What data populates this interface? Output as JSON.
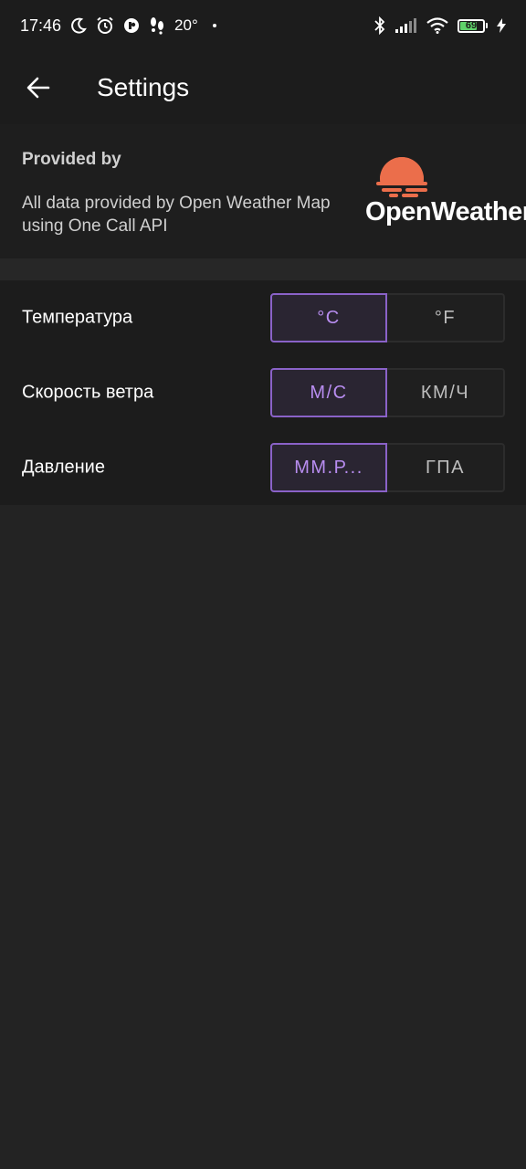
{
  "status_bar": {
    "time": "17:46",
    "temperature": "20°",
    "battery": "69",
    "icons": [
      "moon-icon",
      "alarm-icon",
      "app-notification-icon",
      "footsteps-icon",
      "bluetooth-icon",
      "signal-icon",
      "wifi-icon",
      "battery-icon",
      "charging-icon"
    ]
  },
  "app_bar": {
    "title": "Settings",
    "back_icon": "arrow-left-icon"
  },
  "provider": {
    "heading": "Provided by",
    "description": "All data provided by Open Weather Map using One Call API",
    "logo_text": "OpenWeather",
    "logo_color": "#eb6e4b"
  },
  "settings": [
    {
      "label": "Температура",
      "options": [
        "°C",
        "°F"
      ],
      "selected": 0
    },
    {
      "label": "Скорость ветра",
      "options": [
        "М/С",
        "КМ/Ч"
      ],
      "selected": 0
    },
    {
      "label": "Давление",
      "options": [
        "ММ.Р...",
        "ГПА"
      ],
      "selected": 0
    }
  ],
  "colors": {
    "accent": "#b88df0",
    "accent_border": "#8a62c8",
    "background": "#232323",
    "surface": "#1c1c1c"
  }
}
